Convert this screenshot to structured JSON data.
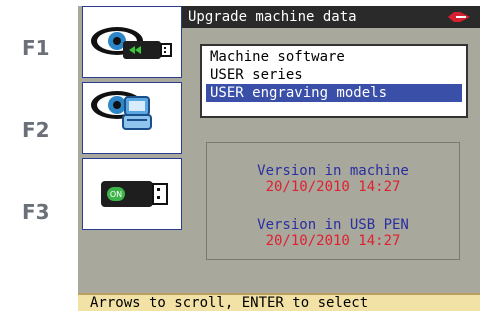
{
  "fkeys": [
    "F1",
    "F2",
    "F3"
  ],
  "title": "Upgrade machine data",
  "menu": {
    "items": [
      "Machine software",
      "USER series",
      "USER engraving models"
    ],
    "selected_index": 2
  },
  "info": {
    "machine_label": "Version in machine",
    "machine_value": "20/10/2010 14:27",
    "usb_label": "Version in USB PEN",
    "usb_value": "20/10/2010 14:27"
  },
  "status": "Arrows to scroll, ENTER to select",
  "icons": {
    "f1": "eye-usb-icon",
    "f2": "eye-computer-icon",
    "f3": "usb-on-icon"
  },
  "colors": {
    "selection": "#3a4fa8",
    "label_blue": "#2a2fa0",
    "value_red": "#e02030",
    "panel_gray": "#a8a89c",
    "status_bg": "#f2e2a6"
  }
}
